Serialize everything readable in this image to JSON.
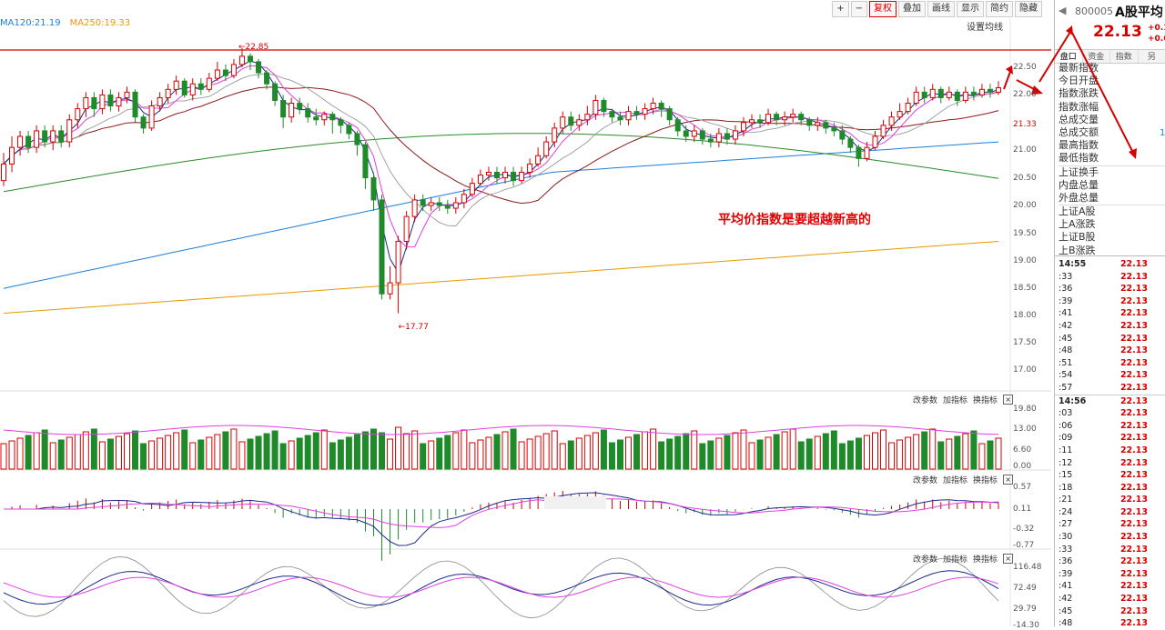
{
  "toolbar": {
    "plus": "+",
    "minus": "−",
    "fuquan": "复权",
    "diejia": "叠加",
    "huaxian": "画线",
    "xianshi": "显示",
    "jianyue": "简约",
    "yincang": "隐藏"
  },
  "ma_legend": {
    "ma120": "MA120:21.19",
    "ma250": "MA250:19.33"
  },
  "set_ma": "设置均线",
  "labels": {
    "high": "22.85",
    "low": "17.77"
  },
  "annotation": "平均价指数是要超越新高的",
  "price_axis": [
    "22.50",
    "22.00",
    "21.33",
    "21.00",
    "20.50",
    "20.00",
    "19.50",
    "19.00",
    "18.50",
    "18.00",
    "17.50",
    "17.00"
  ],
  "vol_axis": [
    "19.80",
    "13.00",
    "6.60",
    "0.00"
  ],
  "macd_axis": [
    "0.57",
    "0.11",
    "-0.32",
    "-0.77"
  ],
  "kdj_axis": [
    "116.48",
    "72.49",
    "29.79",
    "-14.30"
  ],
  "ind_controls": {
    "gaicanshu": "改参数",
    "jiazhibiao": "加指标",
    "huanzhibiao": "换指标",
    "close": "×"
  },
  "stock": {
    "code": "800005",
    "name": "A股平均",
    "price": "22.13",
    "chg": "+0.1",
    "chg_pct": "+0.6"
  },
  "tabs": [
    "盘口",
    "资金",
    "指数",
    "另"
  ],
  "fields": [
    "最新指数",
    "今日开盘",
    "指数涨跌",
    "指数涨幅",
    "总成交量",
    "总成交额",
    "最高指数",
    "最低指数",
    "上证换手",
    "内盘总量",
    "外盘总量",
    "上证A股",
    "上A涨跌",
    "上证B股",
    "上B涨跌"
  ],
  "field_value": "1",
  "ticks": [
    {
      "t": "14:55",
      "p": "22.13"
    },
    {
      "t": ":33",
      "p": "22.13"
    },
    {
      "t": ":36",
      "p": "22.13"
    },
    {
      "t": ":39",
      "p": "22.13"
    },
    {
      "t": ":41",
      "p": "22.13"
    },
    {
      "t": ":42",
      "p": "22.13"
    },
    {
      "t": ":45",
      "p": "22.13"
    },
    {
      "t": ":48",
      "p": "22.13"
    },
    {
      "t": ":51",
      "p": "22.13"
    },
    {
      "t": ":54",
      "p": "22.13"
    },
    {
      "t": ":57",
      "p": "22.13"
    },
    {
      "t": "14:56",
      "p": "22.13"
    },
    {
      "t": ":03",
      "p": "22.13"
    },
    {
      "t": ":06",
      "p": "22.13"
    },
    {
      "t": ":09",
      "p": "22.13"
    },
    {
      "t": ":11",
      "p": "22.13"
    },
    {
      "t": ":12",
      "p": "22.13"
    },
    {
      "t": ":15",
      "p": "22.13"
    },
    {
      "t": ":18",
      "p": "22.13"
    },
    {
      "t": ":21",
      "p": "22.13"
    },
    {
      "t": ":24",
      "p": "22.13"
    },
    {
      "t": ":27",
      "p": "22.13"
    },
    {
      "t": ":30",
      "p": "22.13"
    },
    {
      "t": ":33",
      "p": "22.13"
    },
    {
      "t": ":36",
      "p": "22.13"
    },
    {
      "t": ":39",
      "p": "22.13"
    },
    {
      "t": ":41",
      "p": "22.13"
    },
    {
      "t": ":42",
      "p": "22.13"
    },
    {
      "t": ":45",
      "p": "22.13"
    },
    {
      "t": ":48",
      "p": "22.13"
    }
  ],
  "candles": [
    [
      20.45,
      20.75,
      20.95,
      20.35
    ],
    [
      20.75,
      21.05,
      21.25,
      20.6
    ],
    [
      21.05,
      21.25,
      21.35,
      20.9
    ],
    [
      21.25,
      21.05,
      21.35,
      20.95
    ],
    [
      21.05,
      21.35,
      21.45,
      20.95
    ],
    [
      21.35,
      21.15,
      21.45,
      21.05
    ],
    [
      21.15,
      21.35,
      21.45,
      21.0
    ],
    [
      21.35,
      21.15,
      21.45,
      21.05
    ],
    [
      21.15,
      21.55,
      21.65,
      21.05
    ],
    [
      21.55,
      21.75,
      21.85,
      21.4
    ],
    [
      21.75,
      21.95,
      22.05,
      21.6
    ],
    [
      21.95,
      21.75,
      22.05,
      21.6
    ],
    [
      21.75,
      22.0,
      22.1,
      21.65
    ],
    [
      22.0,
      21.8,
      22.1,
      21.7
    ],
    [
      21.8,
      21.95,
      22.05,
      21.7
    ],
    [
      21.95,
      22.05,
      22.15,
      21.85
    ],
    [
      22.05,
      21.6,
      22.1,
      21.5
    ],
    [
      21.6,
      21.4,
      21.65,
      21.3
    ],
    [
      21.4,
      21.8,
      21.9,
      21.35
    ],
    [
      21.8,
      21.95,
      22.05,
      21.7
    ],
    [
      21.95,
      22.1,
      22.2,
      21.85
    ],
    [
      22.1,
      22.25,
      22.35,
      22.0
    ],
    [
      22.25,
      22.0,
      22.3,
      21.95
    ],
    [
      22.0,
      22.2,
      22.3,
      21.9
    ],
    [
      22.2,
      22.1,
      22.3,
      22.0
    ],
    [
      22.1,
      22.3,
      22.4,
      22.05
    ],
    [
      22.3,
      22.45,
      22.6,
      22.25
    ],
    [
      22.45,
      22.35,
      22.55,
      22.25
    ],
    [
      22.35,
      22.55,
      22.65,
      22.3
    ],
    [
      22.55,
      22.7,
      22.85,
      22.5
    ],
    [
      22.7,
      22.6,
      22.75,
      22.45
    ],
    [
      22.6,
      22.4,
      22.65,
      22.3
    ],
    [
      22.4,
      22.2,
      22.45,
      22.1
    ],
    [
      22.2,
      21.9,
      22.25,
      21.8
    ],
    [
      21.9,
      21.6,
      22.0,
      21.4
    ],
    [
      21.6,
      21.85,
      21.95,
      21.5
    ],
    [
      21.85,
      21.75,
      21.95,
      21.65
    ],
    [
      21.75,
      21.6,
      21.85,
      21.5
    ],
    [
      21.6,
      21.55,
      21.75,
      21.45
    ],
    [
      21.55,
      21.65,
      21.7,
      21.45
    ],
    [
      21.65,
      21.55,
      21.7,
      21.3
    ],
    [
      21.55,
      21.45,
      21.6,
      21.3
    ],
    [
      21.45,
      21.3,
      21.5,
      21.2
    ],
    [
      21.3,
      21.1,
      21.35,
      20.9
    ],
    [
      21.1,
      20.5,
      21.15,
      20.3
    ],
    [
      20.5,
      20.1,
      20.6,
      19.9
    ],
    [
      20.1,
      18.4,
      20.2,
      18.3
    ],
    [
      18.4,
      18.6,
      18.9,
      18.3
    ],
    [
      18.6,
      19.35,
      19.45,
      18.05
    ],
    [
      19.35,
      19.8,
      19.9,
      19.2
    ],
    [
      19.8,
      20.1,
      20.2,
      19.7
    ],
    [
      20.1,
      20.0,
      20.2,
      19.9
    ],
    [
      20.0,
      20.05,
      20.15,
      19.9
    ],
    [
      20.05,
      20.0,
      20.15,
      19.9
    ],
    [
      20.0,
      19.95,
      20.1,
      19.85
    ],
    [
      19.95,
      20.05,
      20.15,
      19.85
    ],
    [
      20.05,
      20.2,
      20.3,
      19.95
    ],
    [
      20.2,
      20.4,
      20.5,
      20.15
    ],
    [
      20.4,
      20.55,
      20.65,
      20.35
    ],
    [
      20.55,
      20.6,
      20.7,
      20.45
    ],
    [
      20.6,
      20.5,
      20.7,
      20.4
    ],
    [
      20.5,
      20.6,
      20.7,
      20.4
    ],
    [
      20.6,
      20.45,
      20.7,
      20.35
    ],
    [
      20.45,
      20.6,
      20.7,
      20.4
    ],
    [
      20.6,
      20.75,
      20.85,
      20.5
    ],
    [
      20.75,
      20.9,
      21.05,
      20.7
    ],
    [
      20.9,
      21.15,
      21.25,
      20.85
    ],
    [
      21.15,
      21.4,
      21.5,
      21.05
    ],
    [
      21.4,
      21.6,
      21.7,
      21.3
    ],
    [
      21.6,
      21.45,
      21.7,
      21.35
    ],
    [
      21.45,
      21.55,
      21.65,
      21.35
    ],
    [
      21.55,
      21.65,
      21.8,
      21.45
    ],
    [
      21.65,
      21.9,
      22.0,
      21.55
    ],
    [
      21.9,
      21.7,
      21.95,
      21.6
    ],
    [
      21.7,
      21.6,
      21.75,
      21.5
    ],
    [
      21.6,
      21.55,
      21.7,
      21.45
    ],
    [
      21.55,
      21.7,
      21.8,
      21.45
    ],
    [
      21.7,
      21.65,
      21.8,
      21.55
    ],
    [
      21.65,
      21.75,
      21.85,
      21.55
    ],
    [
      21.75,
      21.85,
      21.95,
      21.65
    ],
    [
      21.85,
      21.75,
      21.9,
      21.6
    ],
    [
      21.75,
      21.55,
      21.8,
      21.45
    ],
    [
      21.55,
      21.35,
      21.6,
      21.25
    ],
    [
      21.35,
      21.25,
      21.45,
      21.15
    ],
    [
      21.25,
      21.35,
      21.45,
      21.15
    ],
    [
      21.35,
      21.2,
      21.4,
      21.1
    ],
    [
      21.2,
      21.15,
      21.3,
      21.05
    ],
    [
      21.15,
      21.3,
      21.4,
      21.05
    ],
    [
      21.3,
      21.2,
      21.4,
      21.1
    ],
    [
      21.2,
      21.35,
      21.45,
      21.1
    ],
    [
      21.35,
      21.5,
      21.6,
      21.25
    ],
    [
      21.5,
      21.55,
      21.65,
      21.4
    ],
    [
      21.55,
      21.5,
      21.65,
      21.4
    ],
    [
      21.5,
      21.65,
      21.75,
      21.45
    ],
    [
      21.65,
      21.55,
      21.7,
      21.45
    ],
    [
      21.55,
      21.6,
      21.7,
      21.45
    ],
    [
      21.6,
      21.65,
      21.75,
      21.5
    ],
    [
      21.65,
      21.55,
      21.7,
      21.45
    ],
    [
      21.55,
      21.45,
      21.6,
      21.35
    ],
    [
      21.45,
      21.5,
      21.6,
      21.35
    ],
    [
      21.5,
      21.4,
      21.55,
      21.3
    ],
    [
      21.4,
      21.35,
      21.5,
      21.25
    ],
    [
      21.35,
      21.2,
      21.45,
      21.1
    ],
    [
      21.2,
      21.05,
      21.25,
      20.95
    ],
    [
      21.05,
      20.85,
      21.1,
      20.7
    ],
    [
      20.85,
      21.05,
      21.15,
      20.8
    ],
    [
      21.05,
      21.25,
      21.35,
      21.0
    ],
    [
      21.25,
      21.45,
      21.55,
      21.2
    ],
    [
      21.45,
      21.6,
      21.7,
      21.35
    ],
    [
      21.6,
      21.7,
      21.85,
      21.55
    ],
    [
      21.7,
      21.85,
      21.95,
      21.65
    ],
    [
      21.85,
      22.05,
      22.15,
      21.8
    ],
    [
      22.05,
      21.95,
      22.15,
      21.85
    ],
    [
      21.95,
      22.1,
      22.2,
      21.9
    ],
    [
      22.1,
      21.95,
      22.15,
      21.85
    ],
    [
      21.95,
      22.05,
      22.15,
      21.9
    ],
    [
      22.05,
      21.9,
      22.1,
      21.8
    ],
    [
      21.9,
      22.05,
      22.15,
      21.85
    ],
    [
      22.05,
      22.0,
      22.15,
      21.9
    ],
    [
      22.0,
      22.1,
      22.2,
      21.95
    ],
    [
      22.1,
      22.05,
      22.2,
      21.95
    ],
    [
      22.05,
      22.13,
      22.25,
      22.0
    ]
  ]
}
